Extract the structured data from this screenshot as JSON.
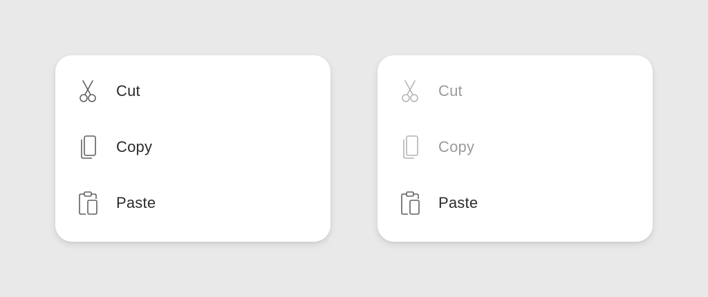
{
  "menus": [
    {
      "state": "enabled",
      "items": [
        {
          "label": "Cut",
          "icon": "scissors-icon",
          "enabled": true
        },
        {
          "label": "Copy",
          "icon": "copy-icon",
          "enabled": true
        },
        {
          "label": "Paste",
          "icon": "clipboard-icon",
          "enabled": true
        }
      ]
    },
    {
      "state": "partially-disabled",
      "items": [
        {
          "label": "Cut",
          "icon": "scissors-icon",
          "enabled": false
        },
        {
          "label": "Copy",
          "icon": "copy-icon",
          "enabled": false
        },
        {
          "label": "Paste",
          "icon": "clipboard-icon",
          "enabled": true
        }
      ]
    }
  ],
  "colors": {
    "background": "#e9e9e9",
    "card": "#ffffff",
    "enabled_text": "#2b2b2b",
    "disabled_text": "#9a9a9a",
    "enabled_icon": "#5f5f5f",
    "disabled_icon": "#b4b4b4"
  }
}
